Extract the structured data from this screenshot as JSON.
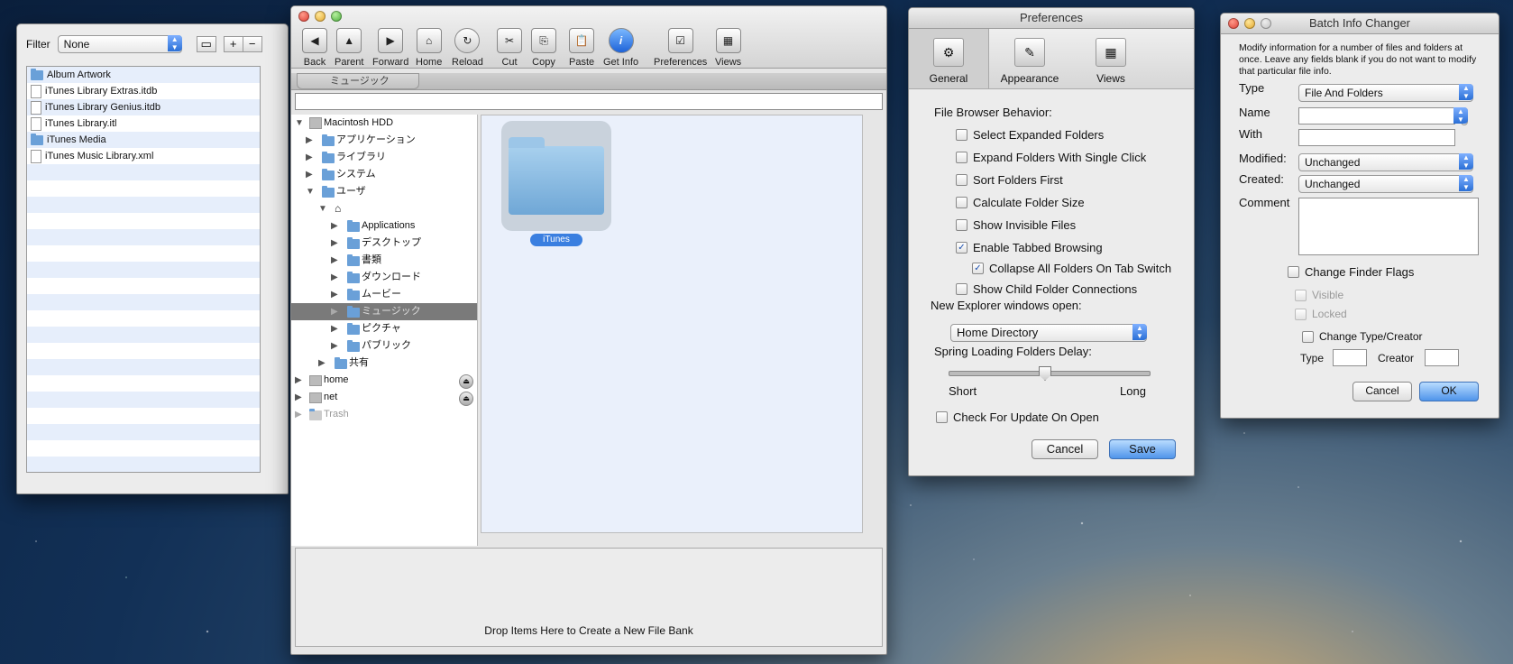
{
  "bank": {
    "filter_label": "Filter",
    "filter_value": "None",
    "add_label": "+",
    "remove_label": "−",
    "items": [
      {
        "name": "Album Artwork",
        "kind": "folder"
      },
      {
        "name": "iTunes Library Extras.itdb",
        "kind": "file"
      },
      {
        "name": "iTunes Library Genius.itdb",
        "kind": "file"
      },
      {
        "name": "iTunes Library.itl",
        "kind": "file"
      },
      {
        "name": "iTunes Media",
        "kind": "folder"
      },
      {
        "name": "iTunes Music Library.xml",
        "kind": "file"
      }
    ]
  },
  "explorer": {
    "toolbar": {
      "back": "Back",
      "parent": "Parent",
      "forward": "Forward",
      "home": "Home",
      "reload": "Reload",
      "cut": "Cut",
      "copy": "Copy",
      "paste": "Paste",
      "get_info": "Get Info",
      "preferences": "Preferences",
      "views": "Views"
    },
    "tab_label": "ミュージック",
    "tree": {
      "root": "Macintosh HDD",
      "apps": "アプリケーション",
      "library": "ライブラリ",
      "system": "システム",
      "users": "ユーザ",
      "applications": "Applications",
      "desktop": "デスクトップ",
      "documents": "書類",
      "downloads": "ダウンロード",
      "movies": "ムービー",
      "music": "ミュージック",
      "pictures": "ピクチャ",
      "public": "パブリック",
      "shared": "共有",
      "home": "home",
      "net": "net",
      "trash": "Trash"
    },
    "content_item": "iTunes",
    "drop_text": "Drop Items Here to Create a New File Bank"
  },
  "prefs": {
    "title": "Preferences",
    "tabs": {
      "general": "General",
      "appearance": "Appearance",
      "views": "Views"
    },
    "section": "File Browser Behavior:",
    "checks": {
      "expanded": "Select Expanded Folders",
      "single_click": "Expand Folders With Single Click",
      "sort": "Sort Folders First",
      "size": "Calculate Folder Size",
      "invisible": "Show Invisible Files",
      "tabbed": "Enable Tabbed Browsing",
      "collapse": "Collapse All Folders On Tab Switch",
      "child": "Show Child Folder Connections",
      "update": "Check For Update On Open"
    },
    "new_windows_label": "New Explorer windows open:",
    "new_windows_value": "Home Directory",
    "spring_label": "Spring Loading Folders Delay:",
    "short": "Short",
    "long": "Long",
    "spring_value": 0.47,
    "cancel": "Cancel",
    "save": "Save"
  },
  "batch": {
    "title": "Batch Info Changer",
    "description": "Modify information for a number of files and folders at once. Leave any fields blank if you do not want to modify that particular file info.",
    "type_label": "Type",
    "type_value": "File And Folders",
    "name_label": "Name",
    "with_label": "With",
    "modified_label": "Modified:",
    "modified_value": "Unchanged",
    "created_label": "Created:",
    "created_value": "Unchanged",
    "comment_label": "Comment",
    "finder_flags": "Change Finder Flags",
    "visible": "Visible",
    "locked": "Locked",
    "type_creator": "Change Type/Creator",
    "type_small": "Type",
    "creator_small": "Creator",
    "cancel": "Cancel",
    "ok": "OK"
  }
}
